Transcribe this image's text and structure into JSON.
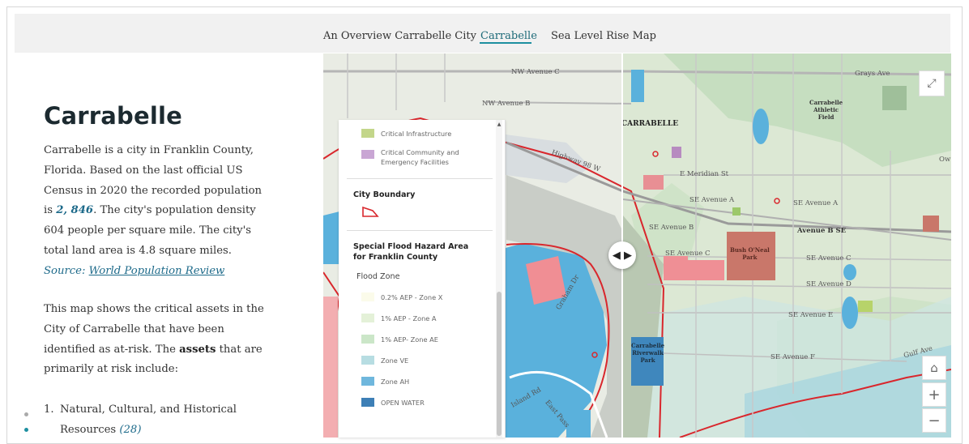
{
  "nav": {
    "tabs": [
      {
        "label": "An Overview Carrabelle City",
        "active": false
      },
      {
        "label": "Carrabelle",
        "active": true
      },
      {
        "label": "Sea Level Rise Map",
        "active": false
      }
    ]
  },
  "story": {
    "title": "Carrabelle",
    "p1_a": "Carrabelle is a city in Franklin County,",
    "p1_b": "Florida. Based on the last official US",
    "p1_c": "Census in 2020 the recorded population",
    "p1_d_pre": "is ",
    "population": "2, 846",
    "p1_d_post": ". The city's population density",
    "p1_e": "604 people per square mile. The city's",
    "p1_f": "total land area is 4.8 square miles.",
    "source_prefix": "Source: ",
    "source_link": "World Population Review",
    "p2_a": "This map shows the critical assets in the",
    "p2_b": "City of Carrabelle that have been",
    "p2_c_pre": "identified as at-risk. The ",
    "p2_c_bold": "assets",
    "p2_c_post": "  that are",
    "p2_d": "primarily at risk include:",
    "list": [
      {
        "num": "1.",
        "line1": "Natural, Cultural, and Historical",
        "line2": "Resources ",
        "count": "(28)"
      }
    ]
  },
  "legend": {
    "items_top": [
      {
        "label": "Critical Infrastructure",
        "color": "#c3d68a"
      },
      {
        "label": "Critical Community and",
        "label2": "Emergency Facilities",
        "color": "#c9a6d4"
      }
    ],
    "city_boundary_heading": "City Boundary",
    "flood_heading_1": "Special Flood Hazard Area",
    "flood_heading_2": "for Franklin County",
    "flood_zone_label": "Flood Zone",
    "zones": [
      {
        "label": "0.2% AEP - Zone X",
        "color": "#fbfbea"
      },
      {
        "label": "1% AEP - Zone A",
        "color": "#e4f1d8"
      },
      {
        "label": "1% AEP- Zone AE",
        "color": "#cbe6c8"
      },
      {
        "label": "Zone VE",
        "color": "#b7dde2"
      },
      {
        "label": "Zone AH",
        "color": "#6fb7dd"
      },
      {
        "label": "OPEN WATER",
        "color": "#3d7fb6"
      }
    ]
  },
  "map": {
    "labels": {
      "nw_ave_c": "NW Avenue C",
      "nw_ave_b": "NW Avenue B",
      "grays_ave": "Grays Ave",
      "carrabelle": "CARRABELLE",
      "athletic_field": "Carrabelle\nAthletic\nField",
      "e_meridian": "E Meridian St",
      "se_ave_a_1": "SE Avenue A",
      "se_ave_a_2": "SE Avenue A",
      "ave_b_se": "Avenue B SE",
      "se_ave_b": "SE Avenue B",
      "se_ave_c_1": "SE Avenue C",
      "se_ave_c_2": "SE Avenue C",
      "se_ave_d": "SE Avenue D",
      "se_ave_e": "SE Avenue E",
      "se_ave_f": "SE Avenue F",
      "bush_oneal": "Bush O'Neal\nPark",
      "riverwalk": "Carrabelle\nRiverwalk\nPark",
      "highway": "Highway 98 W",
      "graham": "Graham Dr",
      "island_rd": "Island Rd",
      "east_pass": "East Pass",
      "gulf_ave": "Gulf Ave",
      "ow": "Ow"
    },
    "controls": {
      "expand": "⤢",
      "home": "⌂",
      "zoom_in": "+",
      "zoom_out": "−",
      "swipe": "◀ ▶"
    }
  }
}
